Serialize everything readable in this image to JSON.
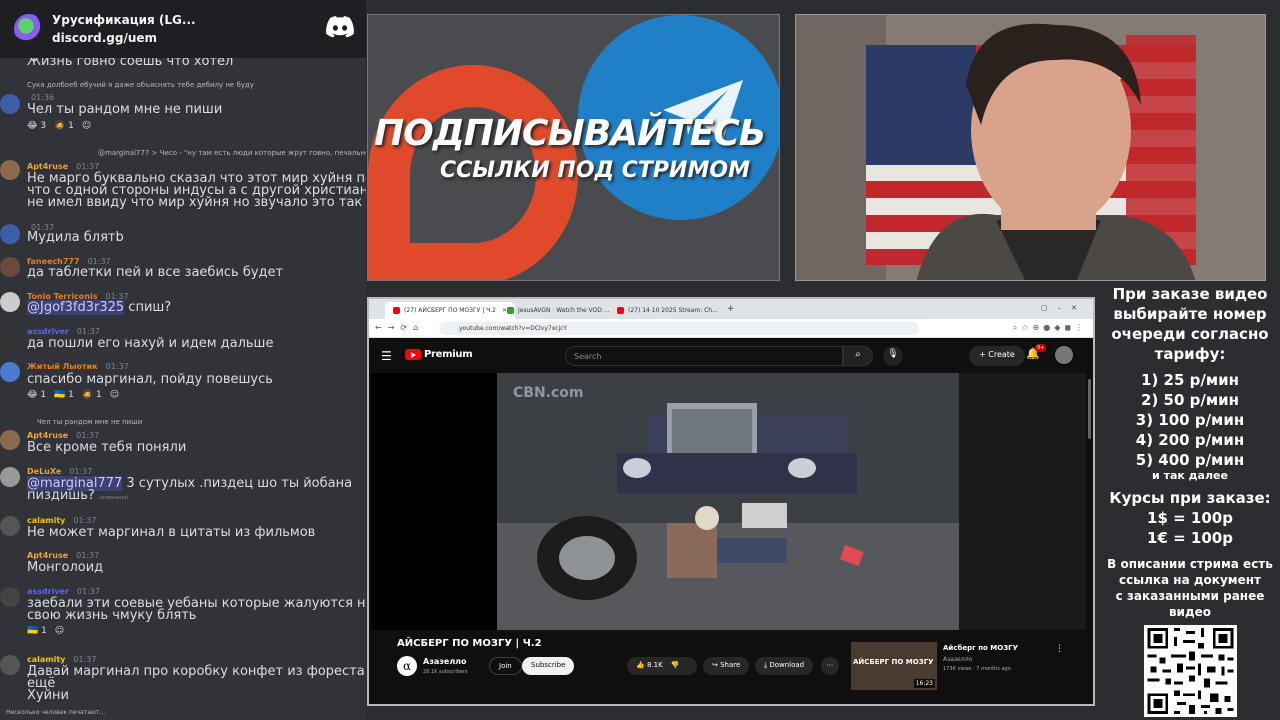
{
  "discord": {
    "server_name": "Урусификация (LG...",
    "server_link": "discord.gg/uem",
    "typing": "Несколько человек печатают...",
    "messages": [
      {
        "reply": "",
        "user": "",
        "time": "",
        "text": "Жизнь говно соешь что хотел",
        "color": "#dbdee1"
      },
      {
        "reply": "Сука долбоеб ебучий я даже объяснять тебе дебилу не буду",
        "user": "",
        "time": "01:36",
        "text": "Чел ты рандом мне не пиши",
        "color": "#dbdee1",
        "reactions": [
          "😂 3",
          "🧔 1",
          "☺"
        ]
      },
      {
        "reply": "@marginal777 > Чисо - \"ну там есть люди которые жрут говно, печально... > ма",
        "user": "Apt4ruse",
        "time": "01:37",
        "text": "Не марго буквально сказал что этот мир хуйня потому",
        "text2": "что с одной стороны индусы а с другой христиане. Он",
        "text3": "не имел ввиду что мир хуйня но звучало это так",
        "color": "#e8a33d"
      },
      {
        "reply": "",
        "user": "",
        "time": "01:37",
        "text": "Мудила блятb",
        "color": "#dbdee1"
      },
      {
        "reply": "",
        "user": "faneech777",
        "time": "01:37",
        "text": "да таблетки пей и все заебись будет",
        "color": "#e67e22"
      },
      {
        "reply": "",
        "user": "Tonio Terriconis",
        "time": "01:37",
        "text": "спиш?",
        "mention": "@Jgof3fd3r325",
        "color": "#e67e22"
      },
      {
        "reply": "",
        "user": "assdriver",
        "time": "01:37",
        "text": "да пошли его нахуй и идем дальше",
        "color": "#5865f2"
      },
      {
        "reply": "",
        "user": "Житый Лыотик",
        "time": "01:37",
        "text": "спасибо маргинал, пойду повешусь",
        "color": "#e67e22",
        "reactions": [
          "😂 1",
          "🇺🇦 1",
          "🧔 1",
          "☺"
        ]
      },
      {
        "reply": "Чел ты рандом мне не пиши",
        "user": "Apt4ruse",
        "time": "01:37",
        "text": "Все кроме тебя поняли",
        "color": "#e8a33d"
      },
      {
        "reply": "",
        "user": "DeLuXe",
        "time": "01:37",
        "text": "3 сутулых .пиздец шо ты йобана",
        "text2": "пиздишь?",
        "mention": "@marginal777",
        "edited": "(изменено)",
        "color": "#e8a33d"
      },
      {
        "reply": "",
        "user": "calamity",
        "time": "01:37",
        "text": "Не может маргинал в цитаты из фильмов",
        "color": "#f1c40f"
      },
      {
        "reply": "",
        "user": "Apt4ruse",
        "time": "01:37",
        "text": "Монголоид",
        "color": "#e8a33d"
      },
      {
        "reply": "",
        "user": "assdriver",
        "time": "01:37",
        "text": "заебали эти соевые уебаны которые жалуются на",
        "text2": "свою жизнь чмуку блять",
        "color": "#5865f2",
        "reactions": [
          "🇺🇦 1",
          "☺"
        ]
      },
      {
        "reply": "",
        "user": "calamity",
        "time": "01:37",
        "text": "Давай маргинал про коробку конфет из фореста гампа",
        "text2": "ещё",
        "text3": "Хуйни",
        "color": "#f1c40f"
      }
    ]
  },
  "banner": {
    "title": "ПОДПИСЫВАЙТЕСЬ",
    "subtitle": "ССЫЛКИ ПОД СТРИМОМ"
  },
  "browser": {
    "tabs": [
      {
        "label": "(27) АЙСБЕРГ ПО МОЗГУ | Ч.2",
        "color": "#ff0000"
      },
      {
        "label": "JesusAVGN · Watch the VOD ...",
        "color": "#22aa22"
      },
      {
        "label": "(27) 14 10 2025 Stream: Ch...",
        "color": "#ff0000"
      }
    ],
    "url": "youtube.com/watch?v=DCIvy7xcjcY"
  },
  "youtube": {
    "brand": "Premium",
    "search_placeholder": "Search",
    "create_label": "Create",
    "notif_badge": "9+",
    "watermark": "CBN.com",
    "video_title": "АЙСБЕРГ ПО МОЗГУ | Ч.2",
    "channel_name": "Азазелло",
    "channel_subs": "28.1K subscribers",
    "join_label": "Join",
    "subscribe_label": "Subscribe",
    "likes": "8.1K",
    "share_label": "Share",
    "download_label": "Download",
    "rec": {
      "thumb_text": "АЙСБЕРГ ПО МОЗГУ",
      "duration": "16:23",
      "title": "Айсберг по МОЗГУ",
      "channel": "Азазелло",
      "stats": "173K views · 7 months ago"
    }
  },
  "info": {
    "l1": "При заказе видео",
    "l2": "выбирайте номер",
    "l3": "очереди согласно",
    "l4": "тарифу:",
    "tariffs": [
      "1) 25 р/мин",
      "2) 50 р/мин",
      "3) 100 р/мин",
      "4) 200 р/мин",
      "5) 400 р/мин"
    ],
    "etc": "и так далее",
    "rates_title": "Курсы при заказе:",
    "rate1": "1$ = 100р",
    "rate2": "1€ = 100р",
    "d1": "В описании стрима есть",
    "d2": "ссылка на документ",
    "d3": "с заказанными ранее",
    "d4": "видео"
  }
}
